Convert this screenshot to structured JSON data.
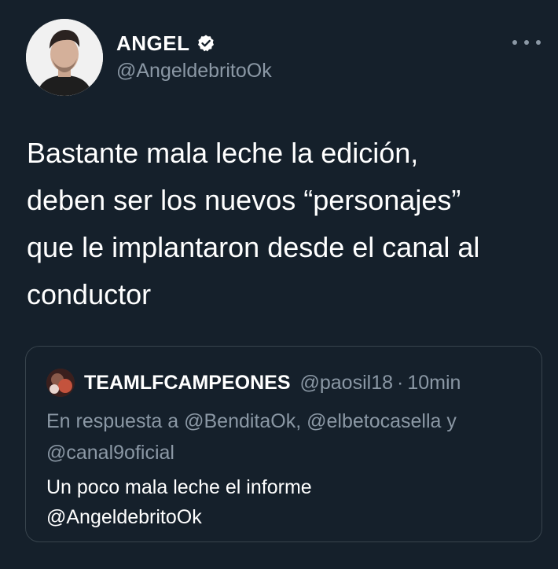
{
  "author": {
    "name": "ANGEL",
    "handle": "@AngeldebritoOk",
    "verified": true
  },
  "tweet": {
    "text": "Bastante mala leche la edición,\ndeben ser los nuevos “personajes”\nque le implantaron desde el canal al\nconductor"
  },
  "quoted_tweet": {
    "name": "TEAMLFCAMPEONES",
    "handle": "@paosil18",
    "separator": "·",
    "time": "10min",
    "reply_to": "En respuesta a @BenditaOk, @elbetocasella y @canal9oficial",
    "text": "Un poco mala leche el informe\n@AngeldebritoOk"
  },
  "icons": {
    "verified": "verified-badge-icon",
    "more": "more-options-icon"
  },
  "colors": {
    "background": "#15202b",
    "primary_text": "#ffffff",
    "secondary_text": "#8b98a5",
    "border": "#38444d"
  }
}
